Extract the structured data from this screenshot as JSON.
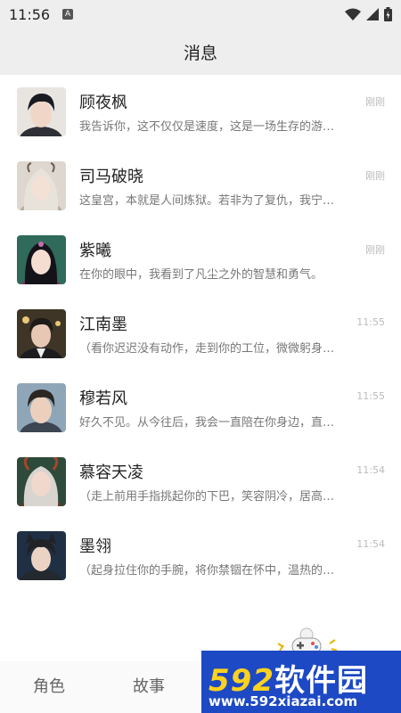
{
  "status_bar": {
    "time": "11:56",
    "notification_badge": "A"
  },
  "header": {
    "title": "消息"
  },
  "messages": [
    {
      "name": "顾夜枫",
      "time": "刚刚",
      "preview": "我告诉你，这不仅仅是速度，这是一场生存的游…"
    },
    {
      "name": "司马破晓",
      "time": "刚刚",
      "preview": "这皇宫，本就是人间炼狱。若非为了复仇，我宁…"
    },
    {
      "name": "紫曦",
      "time": "刚刚",
      "preview": "在你的眼中，我看到了凡尘之外的智慧和勇气。"
    },
    {
      "name": "江南墨",
      "time": "11:55",
      "preview": "（看你迟迟没有动作，走到你的工位，微微躬身…"
    },
    {
      "name": "穆若风",
      "time": "11:55",
      "preview": "好久不见。从今往后，我会一直陪在你身边，直…"
    },
    {
      "name": "慕容天凌",
      "time": "11:54",
      "preview": "（走上前用手指挑起你的下巴，笑容阴冷，居高…"
    },
    {
      "name": "墨翎",
      "time": "11:54",
      "preview": "（起身拉住你的手腕，将你禁锢在怀中，温热的…"
    }
  ],
  "tabs": {
    "role": "角色",
    "story": "故事"
  },
  "watermark": {
    "brand_num": "592",
    "brand_text": "软件园",
    "url": "www.592xiazai.com"
  },
  "colors": {
    "bar_bg": "#eeeeee",
    "time_text": "#bbbbbb",
    "preview_text": "#777777",
    "watermark_bg": "#1d49c4"
  },
  "icons": [
    "wifi-icon",
    "signal-icon",
    "battery-icon",
    "game-controller-icon"
  ]
}
